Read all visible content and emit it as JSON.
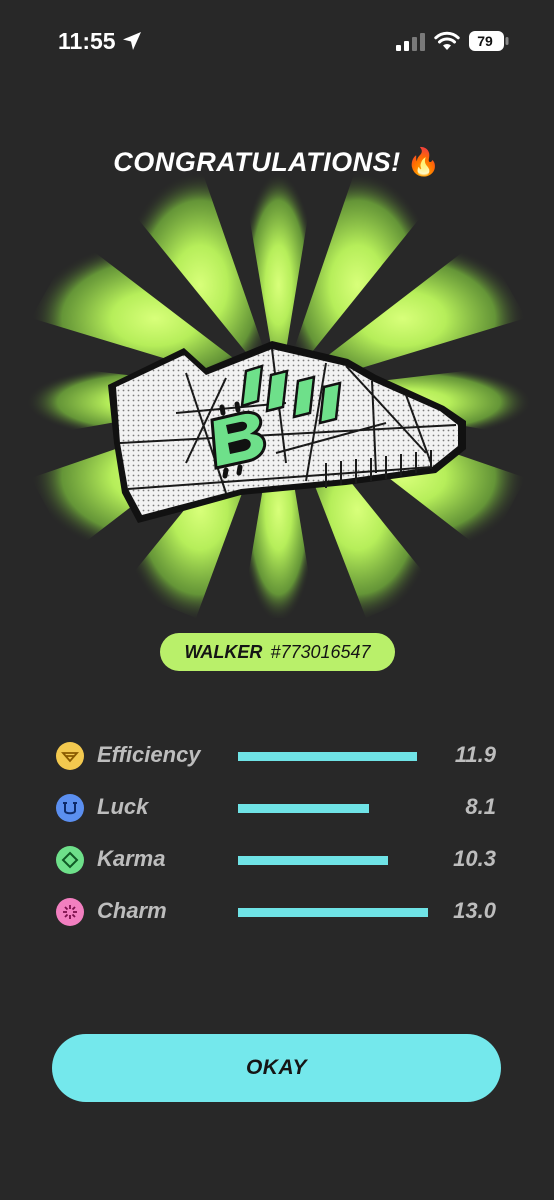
{
  "status_bar": {
    "time": "11:55",
    "battery": "79"
  },
  "title": "CONGRATULATIONS!",
  "title_emoji": "🔥",
  "sneaker": {
    "type": "WALKER",
    "id": "#773016547"
  },
  "stats": [
    {
      "label": "Efficiency",
      "value": "11.9",
      "fraction": 0.94,
      "icon": "efficiency-icon",
      "color": "#f3c94f"
    },
    {
      "label": "Luck",
      "value": "8.1",
      "fraction": 0.69,
      "icon": "luck-icon",
      "color": "#5b8ff0"
    },
    {
      "label": "Karma",
      "value": "10.3",
      "fraction": 0.79,
      "icon": "karma-icon",
      "color": "#6ee08a"
    },
    {
      "label": "Charm",
      "value": "13.0",
      "fraction": 1.0,
      "icon": "charm-icon",
      "color": "#f27fc0"
    }
  ],
  "stat_bar_color": "#6fe3e6",
  "accent": "#b9f06a",
  "okay_label": "OKAY"
}
